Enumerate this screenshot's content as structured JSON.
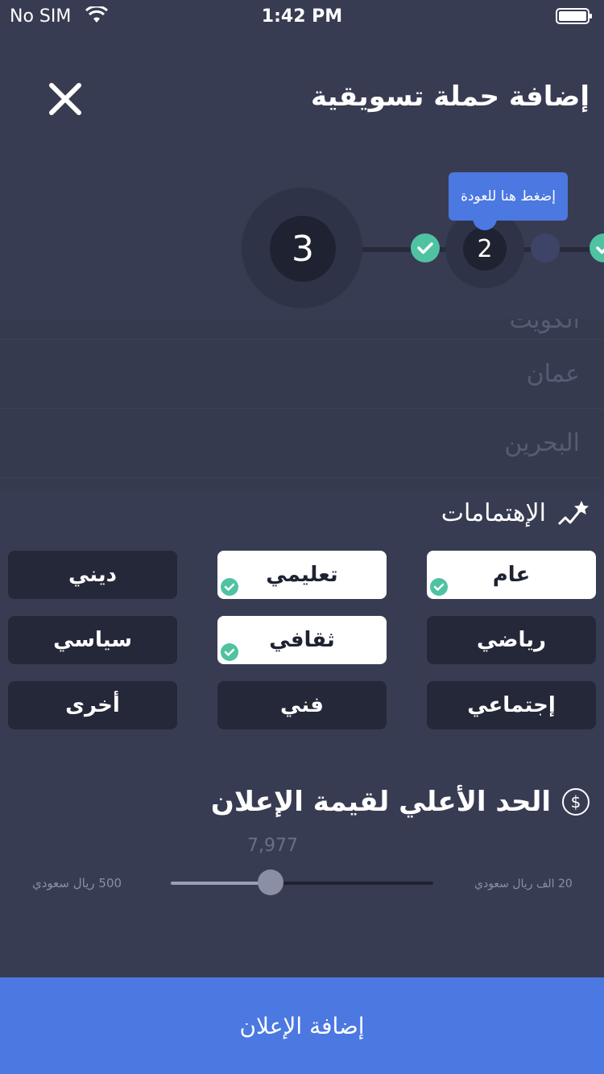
{
  "status_bar": {
    "carrier": "No SIM",
    "time": "1:42 PM"
  },
  "header": {
    "title": "إضافة حملة تسويقية",
    "close_icon": "close-icon"
  },
  "stepper": {
    "current_step": "3",
    "previous_step": "2",
    "tooltip": "إضغط هنا للعودة",
    "check_color": "#4fc3a1"
  },
  "countries": {
    "items": [
      "الكويت",
      "عمان",
      "البحرين"
    ]
  },
  "interests": {
    "title": "الإهتمامات",
    "icon": "trending-star-icon",
    "items": [
      {
        "label": "عام",
        "selected": true
      },
      {
        "label": "تعليمي",
        "selected": true
      },
      {
        "label": "ديني",
        "selected": false
      },
      {
        "label": "رياضي",
        "selected": false
      },
      {
        "label": "ثقافي",
        "selected": true
      },
      {
        "label": "سياسي",
        "selected": false
      },
      {
        "label": "إجتماعي",
        "selected": false
      },
      {
        "label": "فني",
        "selected": false
      },
      {
        "label": "أخرى",
        "selected": false
      }
    ]
  },
  "budget": {
    "title": "الحد الأعلي لقيمة الإعلان",
    "icon": "dollar-icon",
    "icon_symbol": "$",
    "current_value": "7,977",
    "min_label": "500 ريال سعودي",
    "max_label": "20 الف ريال سعودي",
    "slider_fraction": 0.38
  },
  "submit": {
    "label": "إضافة الإعلان"
  },
  "colors": {
    "background": "#383c52",
    "accent": "#4b78e1",
    "chip_dark": "#252838"
  }
}
